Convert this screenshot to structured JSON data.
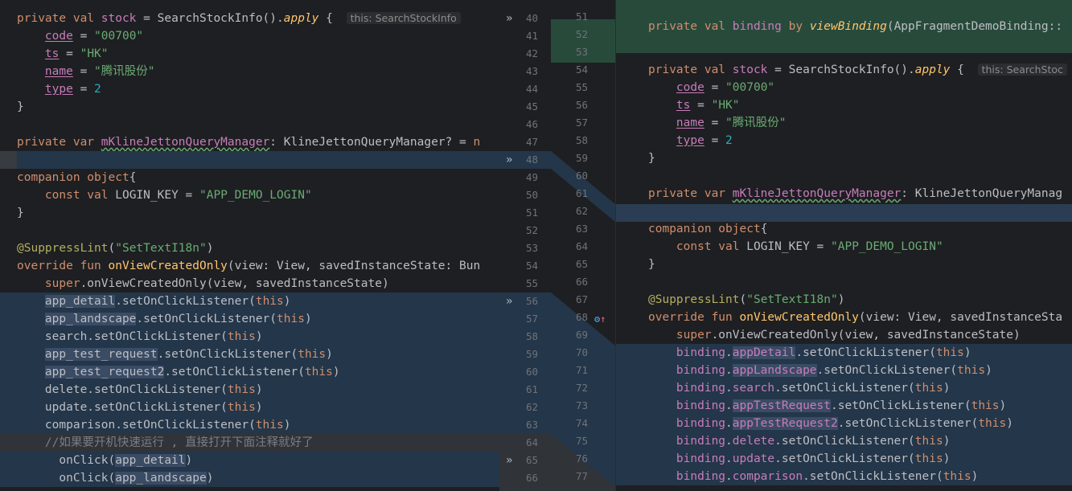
{
  "left_code": {
    "stock_decl": "private val stock = SearchStockInfo().apply {",
    "hint": "this: SearchStockInfo",
    "code_line": "code = \"00700\"",
    "ts_line": "ts = \"HK\"",
    "name_line": "name = \"腾讯股份\"",
    "type_line": "type = 2",
    "close": "}",
    "mgr_line": "private var mKlineJettonQueryManager: KlineJettonQueryManager? = n",
    "companion": "companion object{",
    "const_line": "const val LOGIN_KEY = \"APP_DEMO_LOGIN\"",
    "suppress": "@SuppressLint(\"SetTextI18n\")",
    "override": "override fun onViewCreatedOnly(view: View, savedInstanceState: Bun",
    "super_line": "super.onViewCreatedOnly(view, savedInstanceState)",
    "listeners": [
      "app_detail.setOnClickListener(this)",
      "app_landscape.setOnClickListener(this)",
      "search.setOnClickListener(this)",
      "app_test_request.setOnClickListener(this)",
      "app_test_request2.setOnClickListener(this)",
      "delete.setOnClickListener(this)",
      "update.setOnClickListener(this)",
      "comparison.setOnClickListener(this)"
    ],
    "comment": "//如果要开机快速运行 , 直接打开下面注释就好了",
    "onclick1": "onClick(app_detail)",
    "onclick2": "onClick(app_landscape)"
  },
  "left_numbers": [
    "40",
    "41",
    "42",
    "43",
    "44",
    "45",
    "46",
    "47",
    "48",
    "49",
    "50",
    "51",
    "52",
    "53",
    "54",
    "55",
    "56",
    "57",
    "58",
    "59",
    "60",
    "61",
    "62",
    "63",
    "64",
    "65",
    "66"
  ],
  "right_numbers": [
    "51",
    "52",
    "53",
    "54",
    "55",
    "56",
    "57",
    "58",
    "59",
    "60",
    "61",
    "62",
    "63",
    "64",
    "65",
    "66",
    "67",
    "68",
    "69",
    "70",
    "71",
    "72",
    "73",
    "74",
    "75",
    "76",
    "77"
  ],
  "right_code": {
    "binding_line": "private val binding by viewBinding(AppFragmentDemoBinding::",
    "stock_decl": "private val stock = SearchStockInfo().apply {",
    "hint": "this: SearchStoc",
    "code_line": "code = \"00700\"",
    "ts_line": "ts = \"HK\"",
    "name_line": "name = \"腾讯股份\"",
    "type_line": "type = 2",
    "close": "}",
    "mgr_line": "private var mKlineJettonQueryManager: KlineJettonQueryManag",
    "companion": "companion object{",
    "const_line": "const val LOGIN_KEY = \"APP_DEMO_LOGIN\"",
    "suppress": "@SuppressLint(\"SetTextI18n\")",
    "override": "override fun onViewCreatedOnly(view: View, savedInstanceSta",
    "super_line": "super.onViewCreatedOnly(view, savedInstanceState)",
    "listeners": [
      "binding.appDetail.setOnClickListener(this)",
      "binding.appLandscape.setOnClickListener(this)",
      "binding.search.setOnClickListener(this)",
      "binding.appTestRequest.setOnClickListener(this)",
      "binding.appTestRequest2.setOnClickListener(this)",
      "binding.delete.setOnClickListener(this)",
      "binding.update.setOnClickListener(this)",
      "binding.comparison.setOnClickListener(this)"
    ]
  },
  "colors": {
    "changed": "#243649",
    "added": "#284a3b",
    "background": "#1e1f22"
  }
}
